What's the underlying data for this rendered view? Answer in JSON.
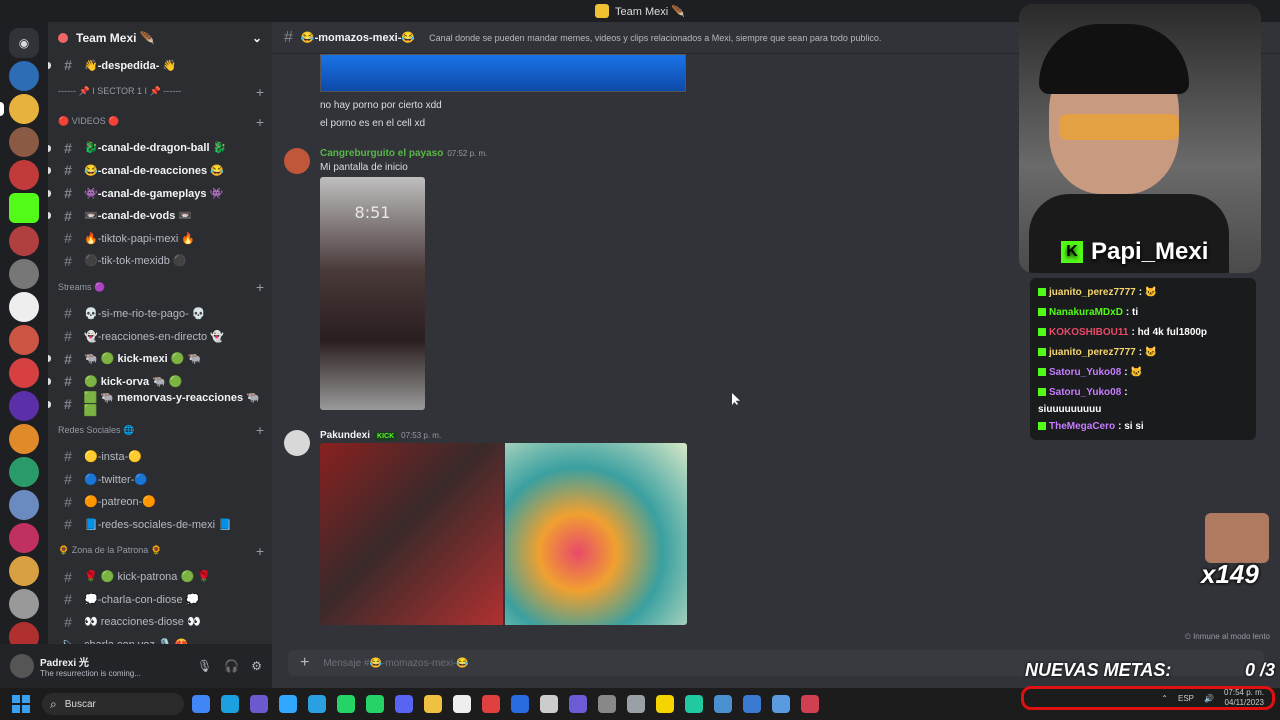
{
  "window": {
    "title": "Team Mexi 🪶"
  },
  "guild": {
    "name": "Team Mexi 🪶"
  },
  "sidebar": {
    "items": [
      {
        "type": "channel",
        "label": "👋-despedida- 👋",
        "unread": true
      },
      {
        "type": "category",
        "label": "------ 📌 I SECTOR 1 I 📌 ------"
      },
      {
        "type": "category",
        "label": "🔴 VIDEOS 🔴"
      },
      {
        "type": "channel",
        "label": "🐉-canal-de-dragon-ball 🐉",
        "unread": true
      },
      {
        "type": "channel",
        "label": "😂-canal-de-reacciones 😂",
        "unread": true
      },
      {
        "type": "channel",
        "label": "👾-canal-de-gameplays 👾",
        "unread": true
      },
      {
        "type": "channel",
        "label": "📼-canal-de-vods 📼",
        "unread": true
      },
      {
        "type": "channel",
        "label": "🔥-tiktok-papi-mexi 🔥",
        "unread": false
      },
      {
        "type": "channel",
        "label": "⚫-tik-tok-mexidb ⚫",
        "unread": false
      },
      {
        "type": "category",
        "label": "Streams 🟣"
      },
      {
        "type": "channel",
        "label": "💀-si-me-rio-te-pago- 💀",
        "unread": false
      },
      {
        "type": "channel",
        "label": "👻-reacciones-en-directo 👻",
        "unread": false
      },
      {
        "type": "channel",
        "label": "🐃 🟢 kick-mexi 🟢 🐃",
        "unread": true
      },
      {
        "type": "channel",
        "label": "🟢 kick-orva 🐃 🟢",
        "unread": true
      },
      {
        "type": "channel",
        "label": "🟩 🐃 memorvas-y-reacciones 🐃 🟩",
        "unread": true
      },
      {
        "type": "category",
        "label": "Redes Sociales 🌐"
      },
      {
        "type": "channel",
        "label": "🟡-insta-🟡",
        "unread": false
      },
      {
        "type": "channel",
        "label": "🔵-twitter-🔵",
        "unread": false
      },
      {
        "type": "channel",
        "label": "🟠-patreon-🟠",
        "unread": false
      },
      {
        "type": "channel",
        "label": "📘-redes-sociales-de-mexi 📘",
        "unread": false
      },
      {
        "type": "category",
        "label": "🌻 Zona de la Patrona 🌻"
      },
      {
        "type": "channel",
        "label": "🌹 🟢 kick-patrona 🟢 🌹",
        "unread": false
      },
      {
        "type": "channel",
        "label": "💭-charla-con-diose 💭",
        "unread": false
      },
      {
        "type": "channel",
        "label": "👀 reacciones-diose 👀",
        "unread": false
      },
      {
        "type": "voice",
        "label": "charla con voz 🎙️ 😍",
        "unread": false
      }
    ]
  },
  "user": {
    "name": "Padrexi 光",
    "status": "The resurrection is coming..."
  },
  "channel": {
    "name": "😂-momazos-mexi-😂",
    "topic": "Canal donde se pueden mandar memes, videos y clips relacionados a Mexi, siempre que sean para todo publico."
  },
  "messages": {
    "m1": "no hay porno por cierto xdd",
    "m2": "el porno es en el cell xd",
    "m3_author": "Cangreburguito el payaso",
    "m3_time": "07:52 p. m.",
    "m3_text": "Mi pantalla de inicio",
    "m3_img_time": "8:51",
    "m4_author": "Pakundexi",
    "m4_badge": "KICK",
    "m4_time": "07:53 p. m."
  },
  "composer": {
    "placeholder": "Mensaje #😂-momazos-mexi-😂"
  },
  "slowmode": "Inmune al modo lento",
  "overlay": {
    "streamer": "Papi_Mexi",
    "chat": [
      {
        "user": "juanito_perez7777",
        "color": "#f5d76e",
        "text": ": 🐱"
      },
      {
        "user": "NanakuraMDxD",
        "color": "#53fc18",
        "text": ": ti"
      },
      {
        "user": "KOKOSHIBOU11",
        "color": "#e84a6a",
        "text": ": hd 4k ful1800p"
      },
      {
        "user": "juanito_perez7777",
        "color": "#f5d76e",
        "text": ": 🐱"
      },
      {
        "user": "Satoru_Yuko08",
        "color": "#c77dff",
        "text": ": 🐱"
      },
      {
        "user": "Satoru_Yuko08",
        "color": "#c77dff",
        "text": ":"
      },
      {
        "user": "",
        "color": "#ffffff",
        "text": "siuuuuuuuuu"
      },
      {
        "user": "TheMegaCero",
        "color": "#c77dff",
        "text": ": si si"
      }
    ],
    "emote_count": "x149",
    "goals_label": "NUEVAS METAS:",
    "goals_value": "0 /3"
  },
  "taskbar": {
    "search": "Buscar",
    "lang": "ESP",
    "time": "07:54 p. m.",
    "date": "04/11/2023"
  },
  "colors": {
    "kick": "#53fc18",
    "blurple": "#5865f2"
  }
}
